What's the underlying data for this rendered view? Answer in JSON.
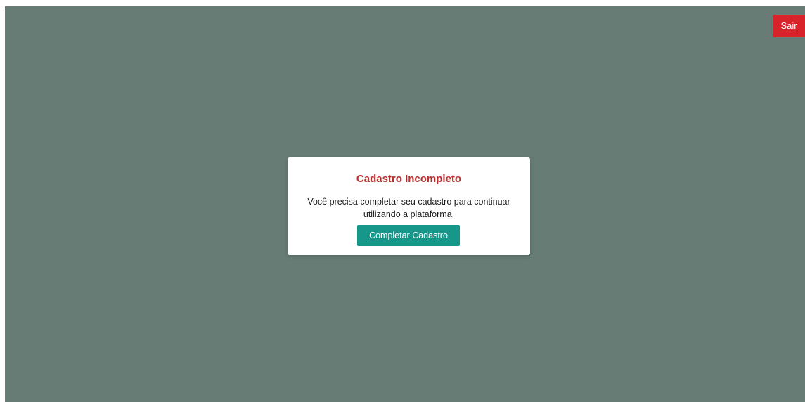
{
  "header": {
    "logout_label": "Sair"
  },
  "modal": {
    "title": "Cadastro Incompleto",
    "message": "Você precisa completar seu cadastro para continuar utilizando a plataforma.",
    "button_label": "Completar Cadastro"
  },
  "colors": {
    "overlay": "#667c75",
    "logout_button": "#d9232b",
    "title": "#b83232",
    "primary_button": "#17968a"
  }
}
